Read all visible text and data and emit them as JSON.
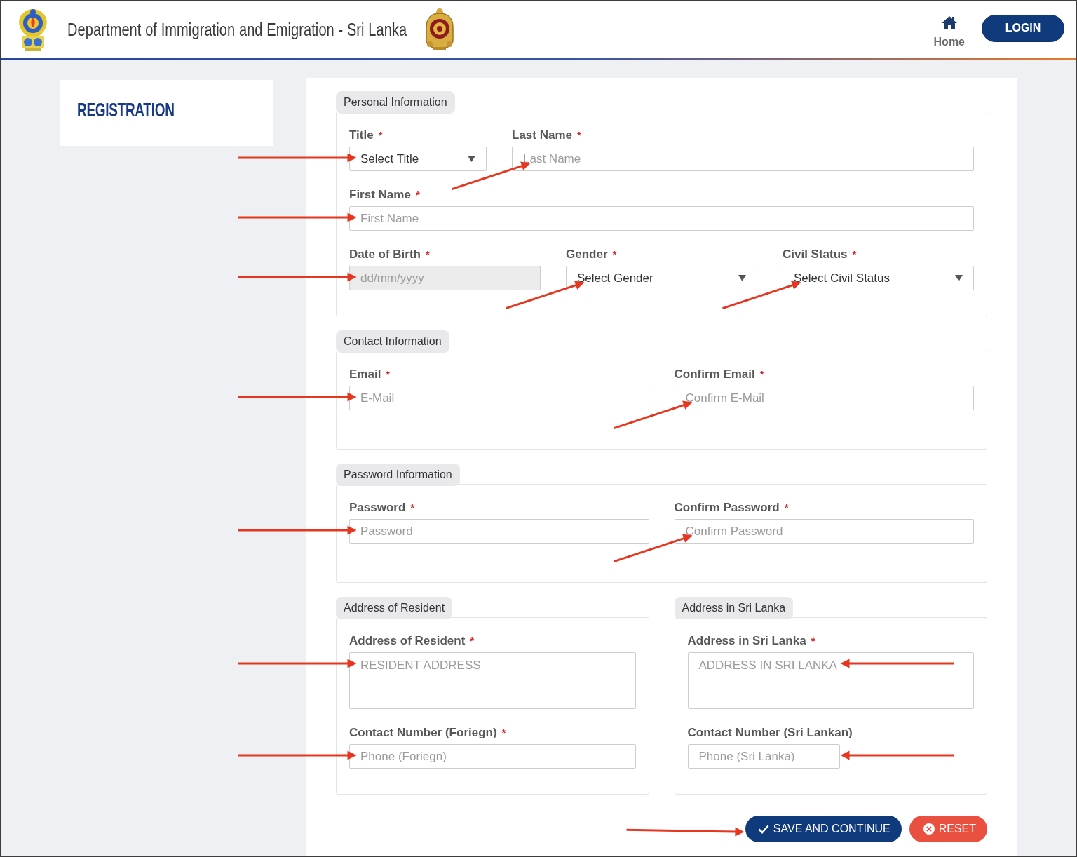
{
  "header": {
    "title": "Department of Immigration and Emigration - Sri Lanka",
    "nav": [
      {
        "label": "Home"
      }
    ],
    "login_button": "LOGIN"
  },
  "sidebar": {
    "heading": "REGISTRATION"
  },
  "form": {
    "rows": [
      [
        {
          "legend": "Personal Information",
          "field_rows": [
            [
              {
                "label": "Title",
                "required_mark": "*",
                "kind": "select",
                "value": "Select Title",
                "disabled": false,
                "pointer": {
                  "kind": "from-left"
                }
              },
              {
                "label": "Last Name",
                "required_mark": "*",
                "kind": "text",
                "placeholder": "Last Name",
                "disabled": false,
                "pointer": {
                  "kind": "from-below"
                }
              }
            ],
            [
              {
                "label": "First Name",
                "required_mark": "*",
                "kind": "text",
                "placeholder": "First Name",
                "disabled": false,
                "pointer": {
                  "kind": "from-left"
                }
              }
            ],
            [
              {
                "label": "Date of Birth",
                "required_mark": "*",
                "kind": "date",
                "placeholder": "dd/mm/yyyy",
                "disabled": true,
                "pointer": {
                  "kind": "from-left"
                }
              },
              {
                "label": "Gender",
                "required_mark": "*",
                "kind": "select",
                "value": "Select Gender",
                "disabled": false,
                "pointer": {
                  "kind": "from-below"
                }
              },
              {
                "label": "Civil Status",
                "required_mark": "*",
                "kind": "select",
                "value": "Select Civil Status",
                "disabled": false,
                "pointer": {
                  "kind": "from-below"
                }
              }
            ]
          ]
        }
      ],
      [
        {
          "legend": "Contact Information",
          "field_rows": [
            [
              {
                "label": "Email",
                "required_mark": "*",
                "kind": "email",
                "placeholder": "E-Mail",
                "disabled": false,
                "pointer": {
                  "kind": "from-left"
                }
              },
              {
                "label": "Confirm Email",
                "required_mark": "*",
                "kind": "email",
                "placeholder": "Confirm E-Mail",
                "disabled": false,
                "pointer": {
                  "kind": "from-below"
                }
              }
            ]
          ]
        }
      ],
      [
        {
          "legend": "Password Information",
          "field_rows": [
            [
              {
                "label": "Password",
                "required_mark": "*",
                "kind": "password",
                "placeholder": "Password",
                "disabled": false,
                "pointer": {
                  "kind": "from-left"
                }
              },
              {
                "label": "Confirm Password",
                "required_mark": "*",
                "kind": "password",
                "placeholder": "Confirm Password",
                "disabled": false,
                "pointer": {
                  "kind": "from-below"
                }
              }
            ]
          ]
        }
      ],
      [
        {
          "legend": "Address of Resident",
          "field_rows": [
            [
              {
                "label": "Address of Resident",
                "required_mark": "*",
                "kind": "textarea",
                "placeholder": "RESIDENT ADDRESS",
                "disabled": false,
                "pointer": {
                  "kind": "from-left"
                }
              }
            ],
            [
              {
                "label": "Contact Number (Foriegn)",
                "required_mark": "*",
                "kind": "tel",
                "placeholder": "Phone (Foriegn)",
                "disabled": false,
                "pointer": {
                  "kind": "from-left"
                }
              }
            ]
          ]
        },
        {
          "legend": "Address in Sri Lanka",
          "field_rows": [
            [
              {
                "label": "Address in Sri Lanka",
                "required_mark": "*",
                "kind": "textarea",
                "placeholder": "ADDRESS IN SRI LANKA",
                "disabled": false,
                "pointer": {
                  "kind": "from-right"
                }
              }
            ],
            [
              {
                "label": "Contact Number (Sri Lankan)",
                "kind": "tel",
                "placeholder": "Phone (Sri Lanka)",
                "disabled": false,
                "pointer": {
                  "kind": "from-right"
                }
              }
            ]
          ]
        }
      ]
    ],
    "buttons": [
      {
        "label": "SAVE AND CONTINUE",
        "kind": "primary",
        "pointer": {
          "kind": "from-left"
        }
      },
      {
        "label": "RESET",
        "kind": "reset"
      }
    ]
  }
}
